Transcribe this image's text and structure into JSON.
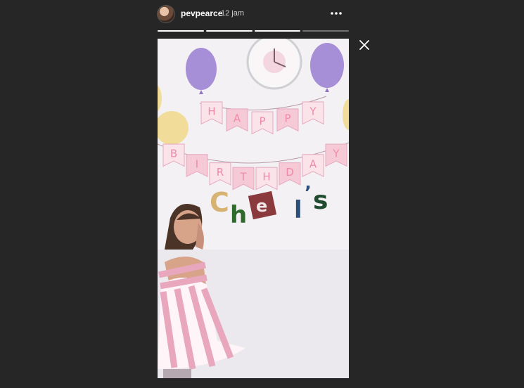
{
  "story": {
    "username": "pevpearce",
    "timestamp": "12 jam",
    "progress": [
      1,
      1,
      1,
      0
    ],
    "image_alt": "Girl in a pink striped dress posing under a Happy Birthday banner",
    "banner_top": [
      "H",
      "A",
      "P",
      "P",
      "Y"
    ],
    "banner_bottom": [
      "B",
      "I",
      "R",
      "T",
      "H",
      "D",
      "A",
      "Y"
    ],
    "name_letters": [
      "C",
      "h",
      "e",
      "l",
      "'",
      "s"
    ]
  },
  "icons": {
    "more": "more-horizontal-icon",
    "close": "close-icon",
    "avatar": "avatar"
  },
  "colors": {
    "background": "#262626",
    "progress_filled": "#ffffff",
    "progress_empty": "rgba(255,255,255,0.35)",
    "balloon_purple": "#a68fd6",
    "balloon_yellow": "#f1dc9a",
    "flag_pink": "#f6c9d7",
    "dress_pink": "#e8a7bd"
  }
}
